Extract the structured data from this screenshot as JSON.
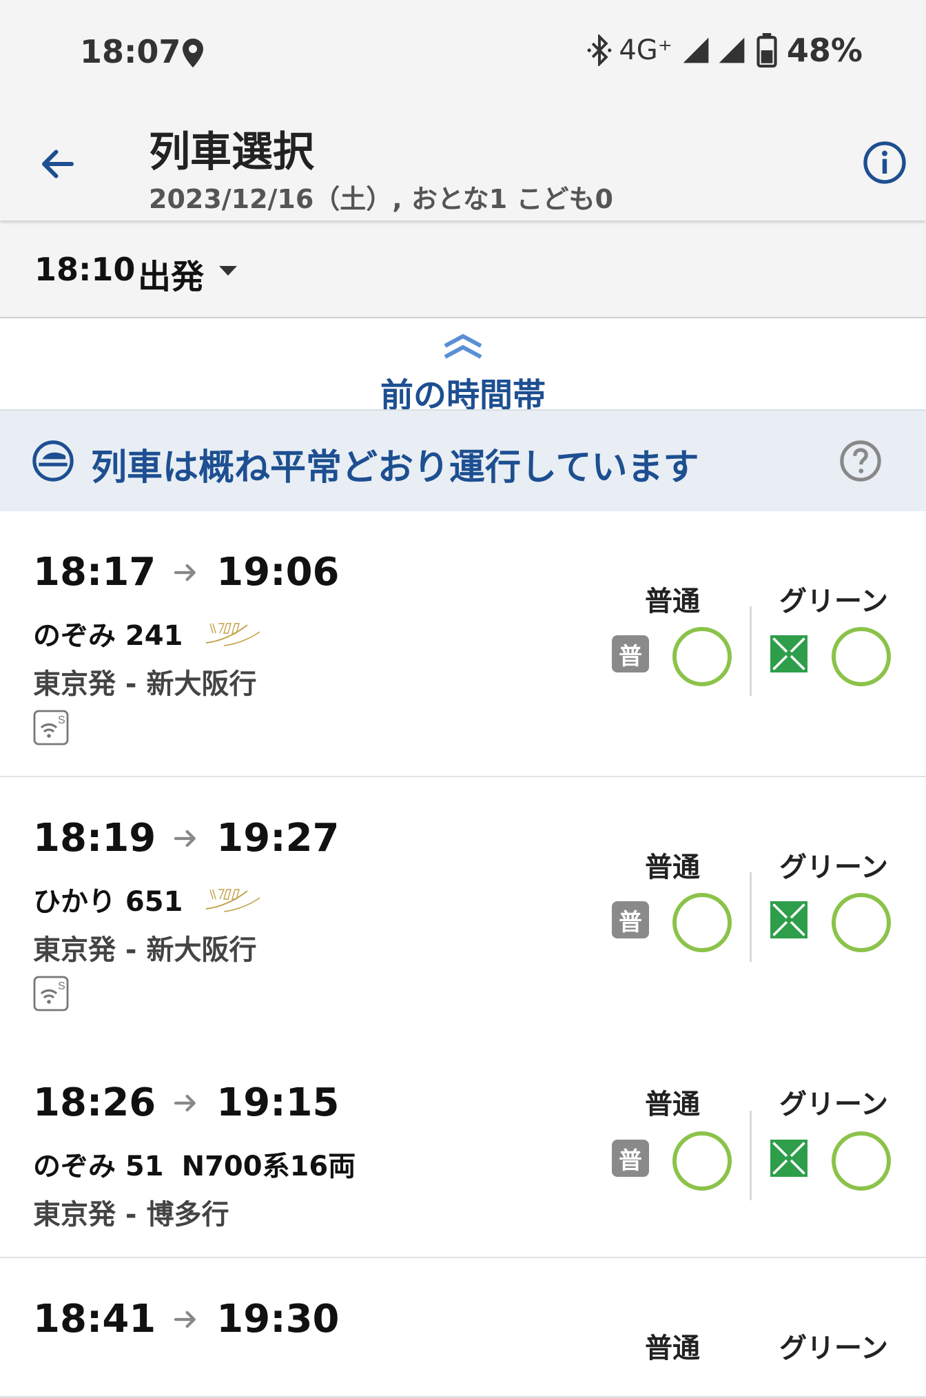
{
  "status_bar": {
    "time": "18:07",
    "network": "4G⁺",
    "battery": "48%"
  },
  "header": {
    "title": "列車選択",
    "subtitle": "2023/12/16（土）, おとな1 こども0"
  },
  "departure": {
    "time": "18:10",
    "label": "出発"
  },
  "previous_timeslot": {
    "label": "前の時間帯"
  },
  "operation_notice": {
    "text": "列車は概ね平常どおり運行しています"
  },
  "class_headers": {
    "ordinary": "普通",
    "green": "グリーン",
    "ordinary_badge": "普"
  },
  "trains": [
    {
      "depart": "18:17",
      "arrive": "19:06",
      "name": "のぞみ 241",
      "car_info": "",
      "route": "東京発 - 新大阪行",
      "logo": "N700S",
      "wifi": true,
      "ordinary_available": "○",
      "green_available": "○"
    },
    {
      "depart": "18:19",
      "arrive": "19:27",
      "name": "ひかり 651",
      "car_info": "",
      "route": "東京発 - 新大阪行",
      "logo": "N700S",
      "wifi": true,
      "ordinary_available": "○",
      "green_available": "○"
    },
    {
      "depart": "18:26",
      "arrive": "19:15",
      "name": "のぞみ 51",
      "car_info": "N700系16両",
      "route": "東京発 - 博多行",
      "logo": "",
      "wifi": false,
      "ordinary_available": "○",
      "green_available": "○"
    },
    {
      "depart": "18:41",
      "arrive": "19:30",
      "name": "",
      "car_info": "",
      "route": "",
      "logo": "",
      "wifi": false,
      "ordinary_available": "",
      "green_available": ""
    }
  ],
  "colors": {
    "accent": "#1d4f91",
    "available": "#8bc34a",
    "green_car": "#2e9e4a"
  }
}
